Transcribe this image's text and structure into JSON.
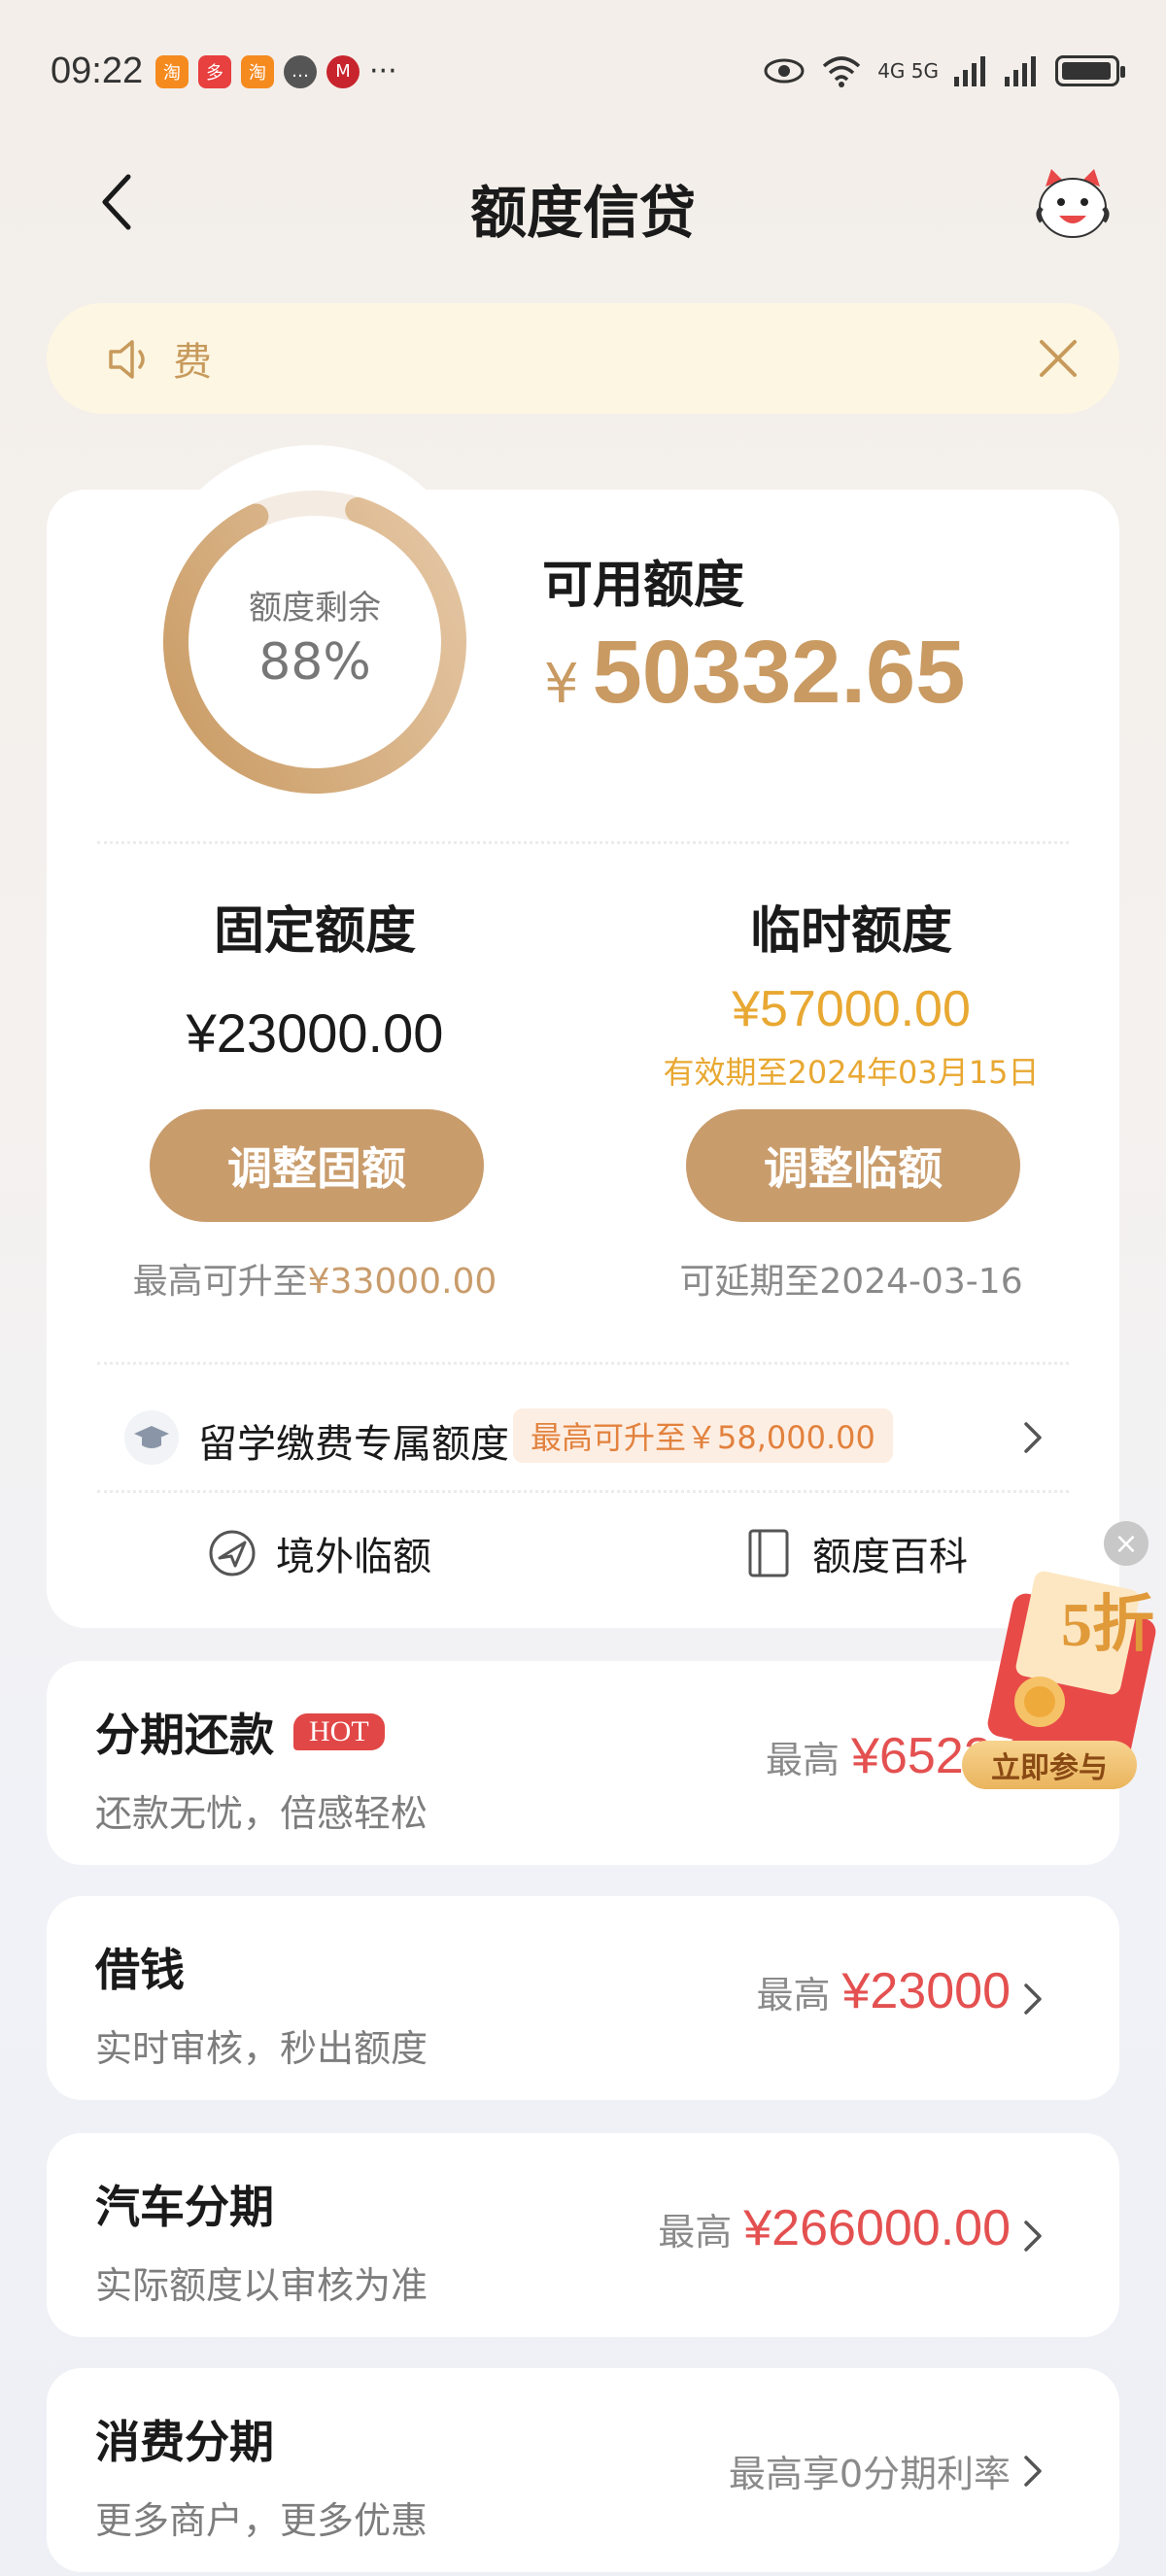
{
  "status_bar": {
    "time": "09:22",
    "network": "4G 5G",
    "more": "···"
  },
  "header": {
    "title": "额度信贷"
  },
  "notice": {
    "text": "费"
  },
  "credit": {
    "ring_label": "额度剩余",
    "ring_percent": 0.88,
    "ring_percent_text": "88%",
    "available_label": "可用额度",
    "currency": "¥",
    "available_amount": "50332.65"
  },
  "fixed": {
    "title": "固定额度",
    "amount": "¥23000.00",
    "button": "调整固额",
    "note_prefix": "最高可升至",
    "note_value": "¥33000.00"
  },
  "temporary": {
    "title": "临时额度",
    "amount": "¥57000.00",
    "valid": "有效期至2024年03月15日",
    "button": "调整临额",
    "note": "可延期至2024-03-16"
  },
  "study": {
    "label": "留学缴费专属额度",
    "tag": "最高可升至￥58,000.00"
  },
  "quick_links": {
    "overseas": "境外临额",
    "wiki": "额度百科"
  },
  "products": [
    {
      "title": "分期还款",
      "badge": "HOT",
      "subtitle": "还款无忧，倍感轻松",
      "prefix": "最高",
      "amount": "¥6522.0"
    },
    {
      "title": "借钱",
      "subtitle": "实时审核，秒出额度",
      "prefix": "最高",
      "amount": "¥23000"
    },
    {
      "title": "汽车分期",
      "subtitle": "实际额度以审核为准",
      "prefix": "最高",
      "amount": "¥266000.00"
    },
    {
      "title": "消费分期",
      "subtitle": "更多商户，更多优惠",
      "text": "最高享0分期利率"
    }
  ],
  "promo": {
    "badge": "5折",
    "button": "立即参与"
  },
  "colors": {
    "accent": "#c99c6c",
    "gold": "#e8a832",
    "red": "#e45050"
  }
}
